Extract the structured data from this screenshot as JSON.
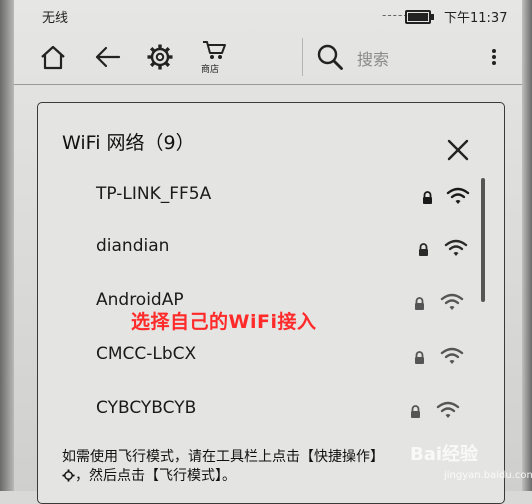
{
  "status_bar": {
    "carrier": "无线",
    "dashes": "-----",
    "clock": "下午11:37"
  },
  "toolbar": {
    "store_label": "商店",
    "search_placeholder": "搜索"
  },
  "dialog": {
    "title": "WiFi 网络（9）",
    "networks": [
      {
        "name": "TP-LINK_FF5A",
        "signal": "strong"
      },
      {
        "name": "diandian",
        "signal": "medium"
      },
      {
        "name": "AndroidAP",
        "signal": "weak"
      },
      {
        "name": "CMCC-LbCX",
        "signal": "weak"
      },
      {
        "name": "CYBCYBCYB",
        "signal": "weak"
      }
    ],
    "hint_line1": "如需使用飞行模式，请在工具栏上点击【快捷操作】",
    "hint_line2": "，然后点击【飞行模式】。"
  },
  "overlay": {
    "caption": "选择自己的WiFi接入"
  },
  "watermark": {
    "text": "Bai经验",
    "url": "jingyan.baidu.com"
  },
  "colors": {
    "caption": "#ff2a2a",
    "screen": "#e4e4e2",
    "ink": "#1a1a1a"
  }
}
